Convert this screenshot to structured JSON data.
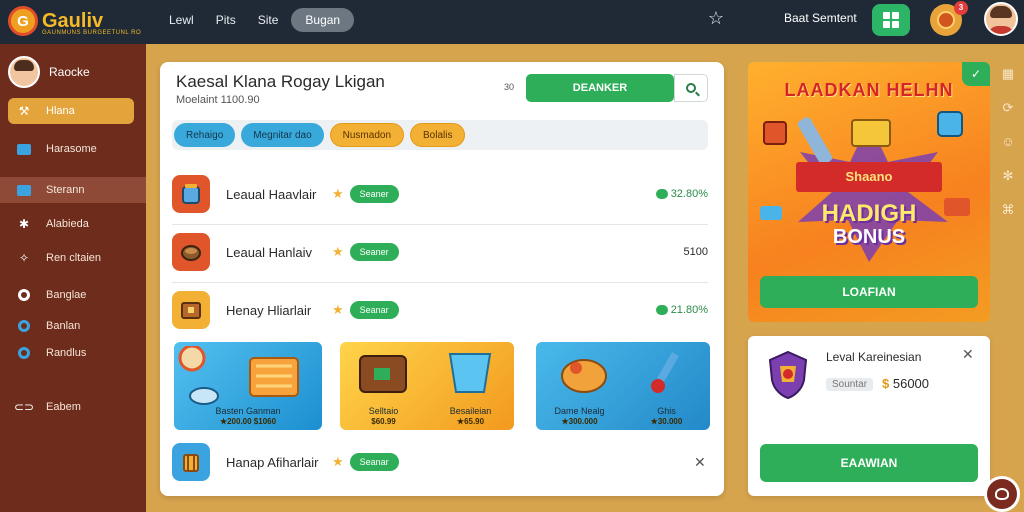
{
  "brand": {
    "name": "Gauliv",
    "tagline": "GAUNMUNS BURGEETUNL RO"
  },
  "topnav": [
    {
      "label": "Lewl"
    },
    {
      "label": "Pits"
    },
    {
      "label": "Site"
    },
    {
      "label": "Bugan"
    }
  ],
  "header": {
    "user_name": "Baat Semtent",
    "notification_count": "3"
  },
  "sidebar": {
    "username": "Raocke",
    "items": [
      {
        "label": "Hlana",
        "icon": "puzzle-icon"
      },
      {
        "label": "Harasome",
        "icon": "window-icon"
      },
      {
        "label": "Sterann",
        "icon": "monitor-icon"
      },
      {
        "label": "Alabieda",
        "icon": "sparkle-icon"
      },
      {
        "label": "Ren cltaien",
        "icon": "gift-icon"
      },
      {
        "label": "Banglae",
        "icon": "circle-icon"
      },
      {
        "label": "Banlan",
        "icon": "circle-icon"
      },
      {
        "label": "Randlus",
        "icon": "circle-icon"
      },
      {
        "label": "Eabem",
        "icon": "link-icon"
      }
    ]
  },
  "main": {
    "title": "Kaesal Klana Rogay Lkigan",
    "subtitle": "Moelaint 1100.90",
    "search_label": "30",
    "primary_button": "DEANKER",
    "chips": [
      "Rehaigo",
      "Megnitar dao",
      "Nusmadon",
      "Bolalis"
    ],
    "rows": [
      {
        "title": "Leaual Haavlair",
        "tag": "Seaner",
        "value": "32.80%",
        "indicator": true
      },
      {
        "title": "Leaual Hanlaiv",
        "tag": "Seaner",
        "value": "5100",
        "indicator": false
      },
      {
        "title": "Henay Hliarlair",
        "tag": "Seanar",
        "value": "21.80%",
        "indicator": true
      },
      {
        "title": "Hanap Afiharlair",
        "tag": "Seanar",
        "value": "",
        "indicator": false
      }
    ],
    "cards": [
      {
        "label": "Basten Ganman",
        "sub": "★200.00 $1060"
      },
      {
        "label": "Selltaio",
        "sub": "$60.99"
      },
      {
        "label": "Besaileian",
        "sub": "★65.90"
      },
      {
        "label": "Dame Nealg",
        "sub": "★300.000"
      },
      {
        "label": "Ghis",
        "sub": "★30.000"
      }
    ]
  },
  "promo": {
    "title": "LAADKAN HELHN",
    "ribbon": "Shaano",
    "big1": "HADIGH",
    "big2": "BONUS",
    "button": "LOAFIAN"
  },
  "offer": {
    "title": "Leval Kareinesian",
    "label": "Sountar",
    "currency": "$",
    "price": "56000",
    "button": "EAAWIAN"
  },
  "colors": {
    "accent": "#2eae58",
    "sidebar": "#6e2c1c",
    "background": "#d7a44e",
    "topbar": "#1f2a36"
  }
}
